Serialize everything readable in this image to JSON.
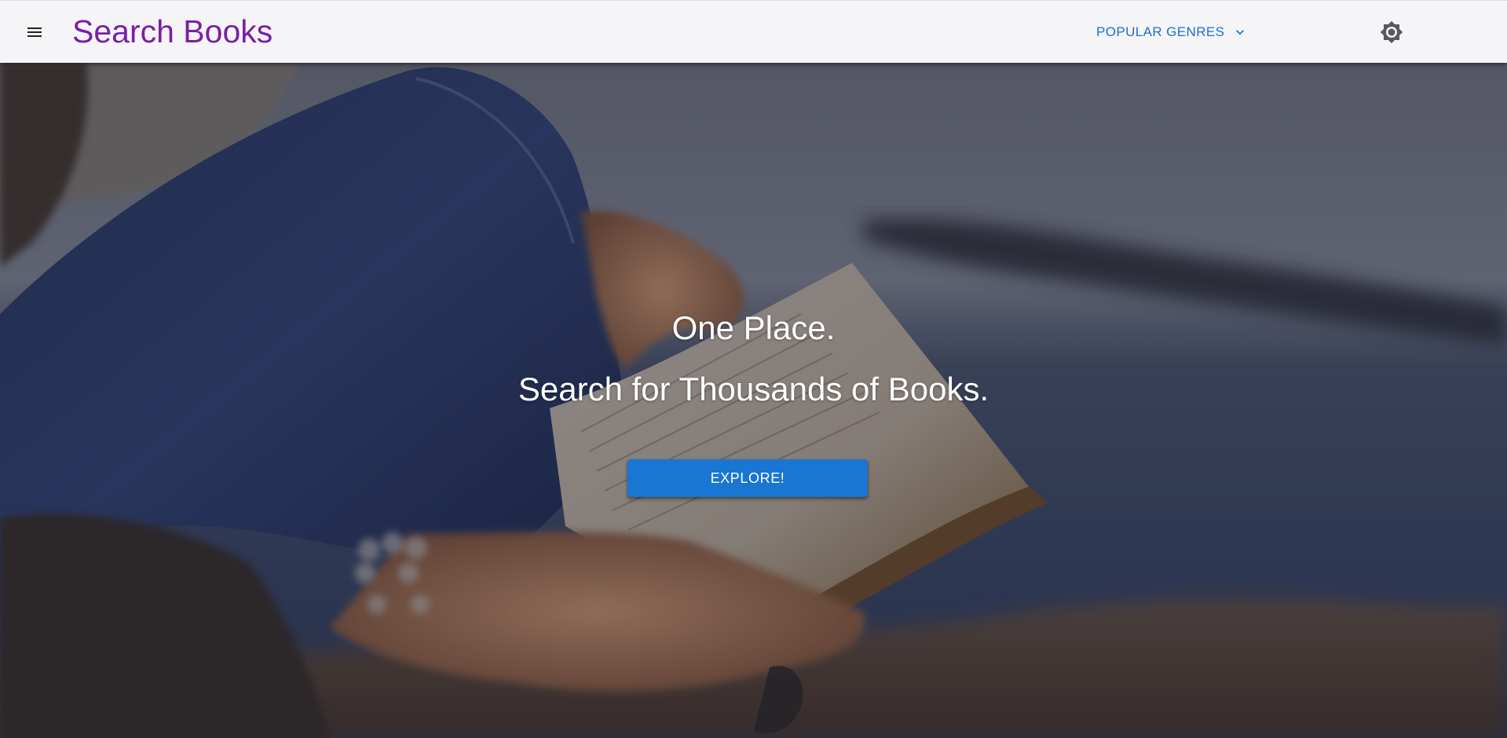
{
  "header": {
    "menu_icon": "hamburger-menu-icon",
    "title": "Search Books",
    "genres_label": "POPULAR GENRES",
    "genres_chevron_icon": "chevron-down-icon",
    "theme_icon": "brightness-toggle-icon"
  },
  "hero": {
    "line1": "One Place.",
    "line2": "Search for Thousands of Books.",
    "cta_label": "EXPLORE!"
  },
  "colors": {
    "brand": "#7b1fa2",
    "accent": "#1976d2",
    "link": "#1e6fc8",
    "appbar_bg": "#f5f5f8"
  }
}
